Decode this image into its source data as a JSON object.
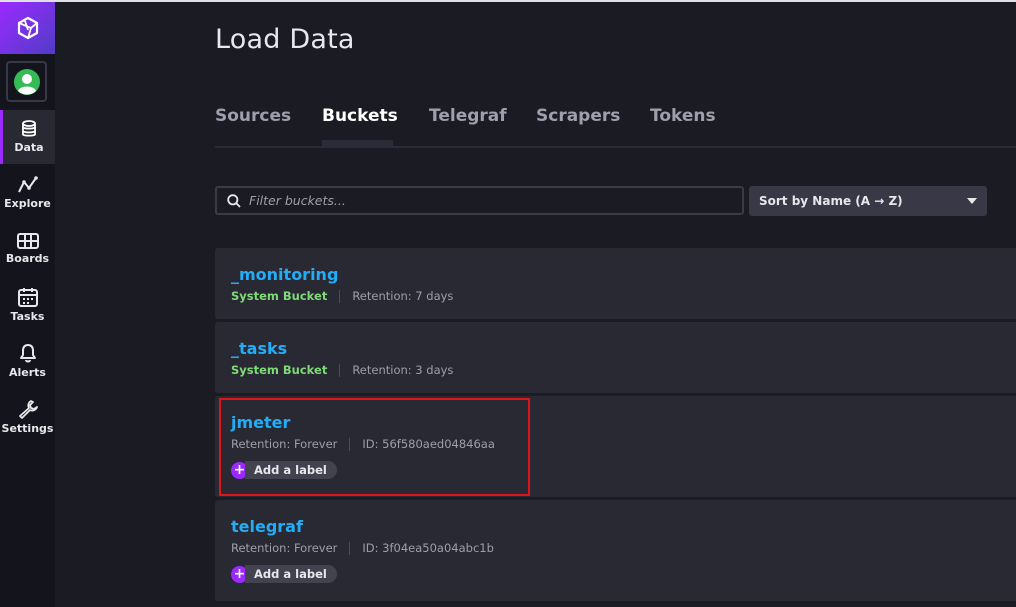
{
  "sidebar": {
    "items": [
      {
        "label": "Data",
        "icon": "database-icon",
        "active": true
      },
      {
        "label": "Explore",
        "icon": "graph-icon"
      },
      {
        "label": "Boards",
        "icon": "dashboard-icon"
      },
      {
        "label": "Tasks",
        "icon": "calendar-icon"
      },
      {
        "label": "Alerts",
        "icon": "bell-icon"
      },
      {
        "label": "Settings",
        "icon": "wrench-icon"
      }
    ]
  },
  "page": {
    "title": "Load Data"
  },
  "tabs": [
    "Sources",
    "Buckets",
    "Telegraf",
    "Scrapers",
    "Tokens"
  ],
  "active_tab": "Buckets",
  "filter": {
    "placeholder": "Filter buckets..."
  },
  "sort": {
    "label": "Sort by Name (A → Z)"
  },
  "buckets": [
    {
      "name": "_monitoring",
      "type": "System Bucket",
      "retention": "Retention: 7 days"
    },
    {
      "name": "_tasks",
      "type": "System Bucket",
      "retention": "Retention: 3 days"
    },
    {
      "name": "jmeter",
      "retention": "Retention: Forever",
      "id": "ID: 56f580aed04846aa",
      "add_label": "Add a label"
    },
    {
      "name": "telegraf",
      "retention": "Retention: Forever",
      "id": "ID: 3f04ea50a04abc1b",
      "add_label": "Add a label"
    }
  ],
  "colors": {
    "accent": "#9b2aff",
    "link": "#22adf6",
    "system": "#7eda77",
    "highlight": "#e0131a"
  }
}
